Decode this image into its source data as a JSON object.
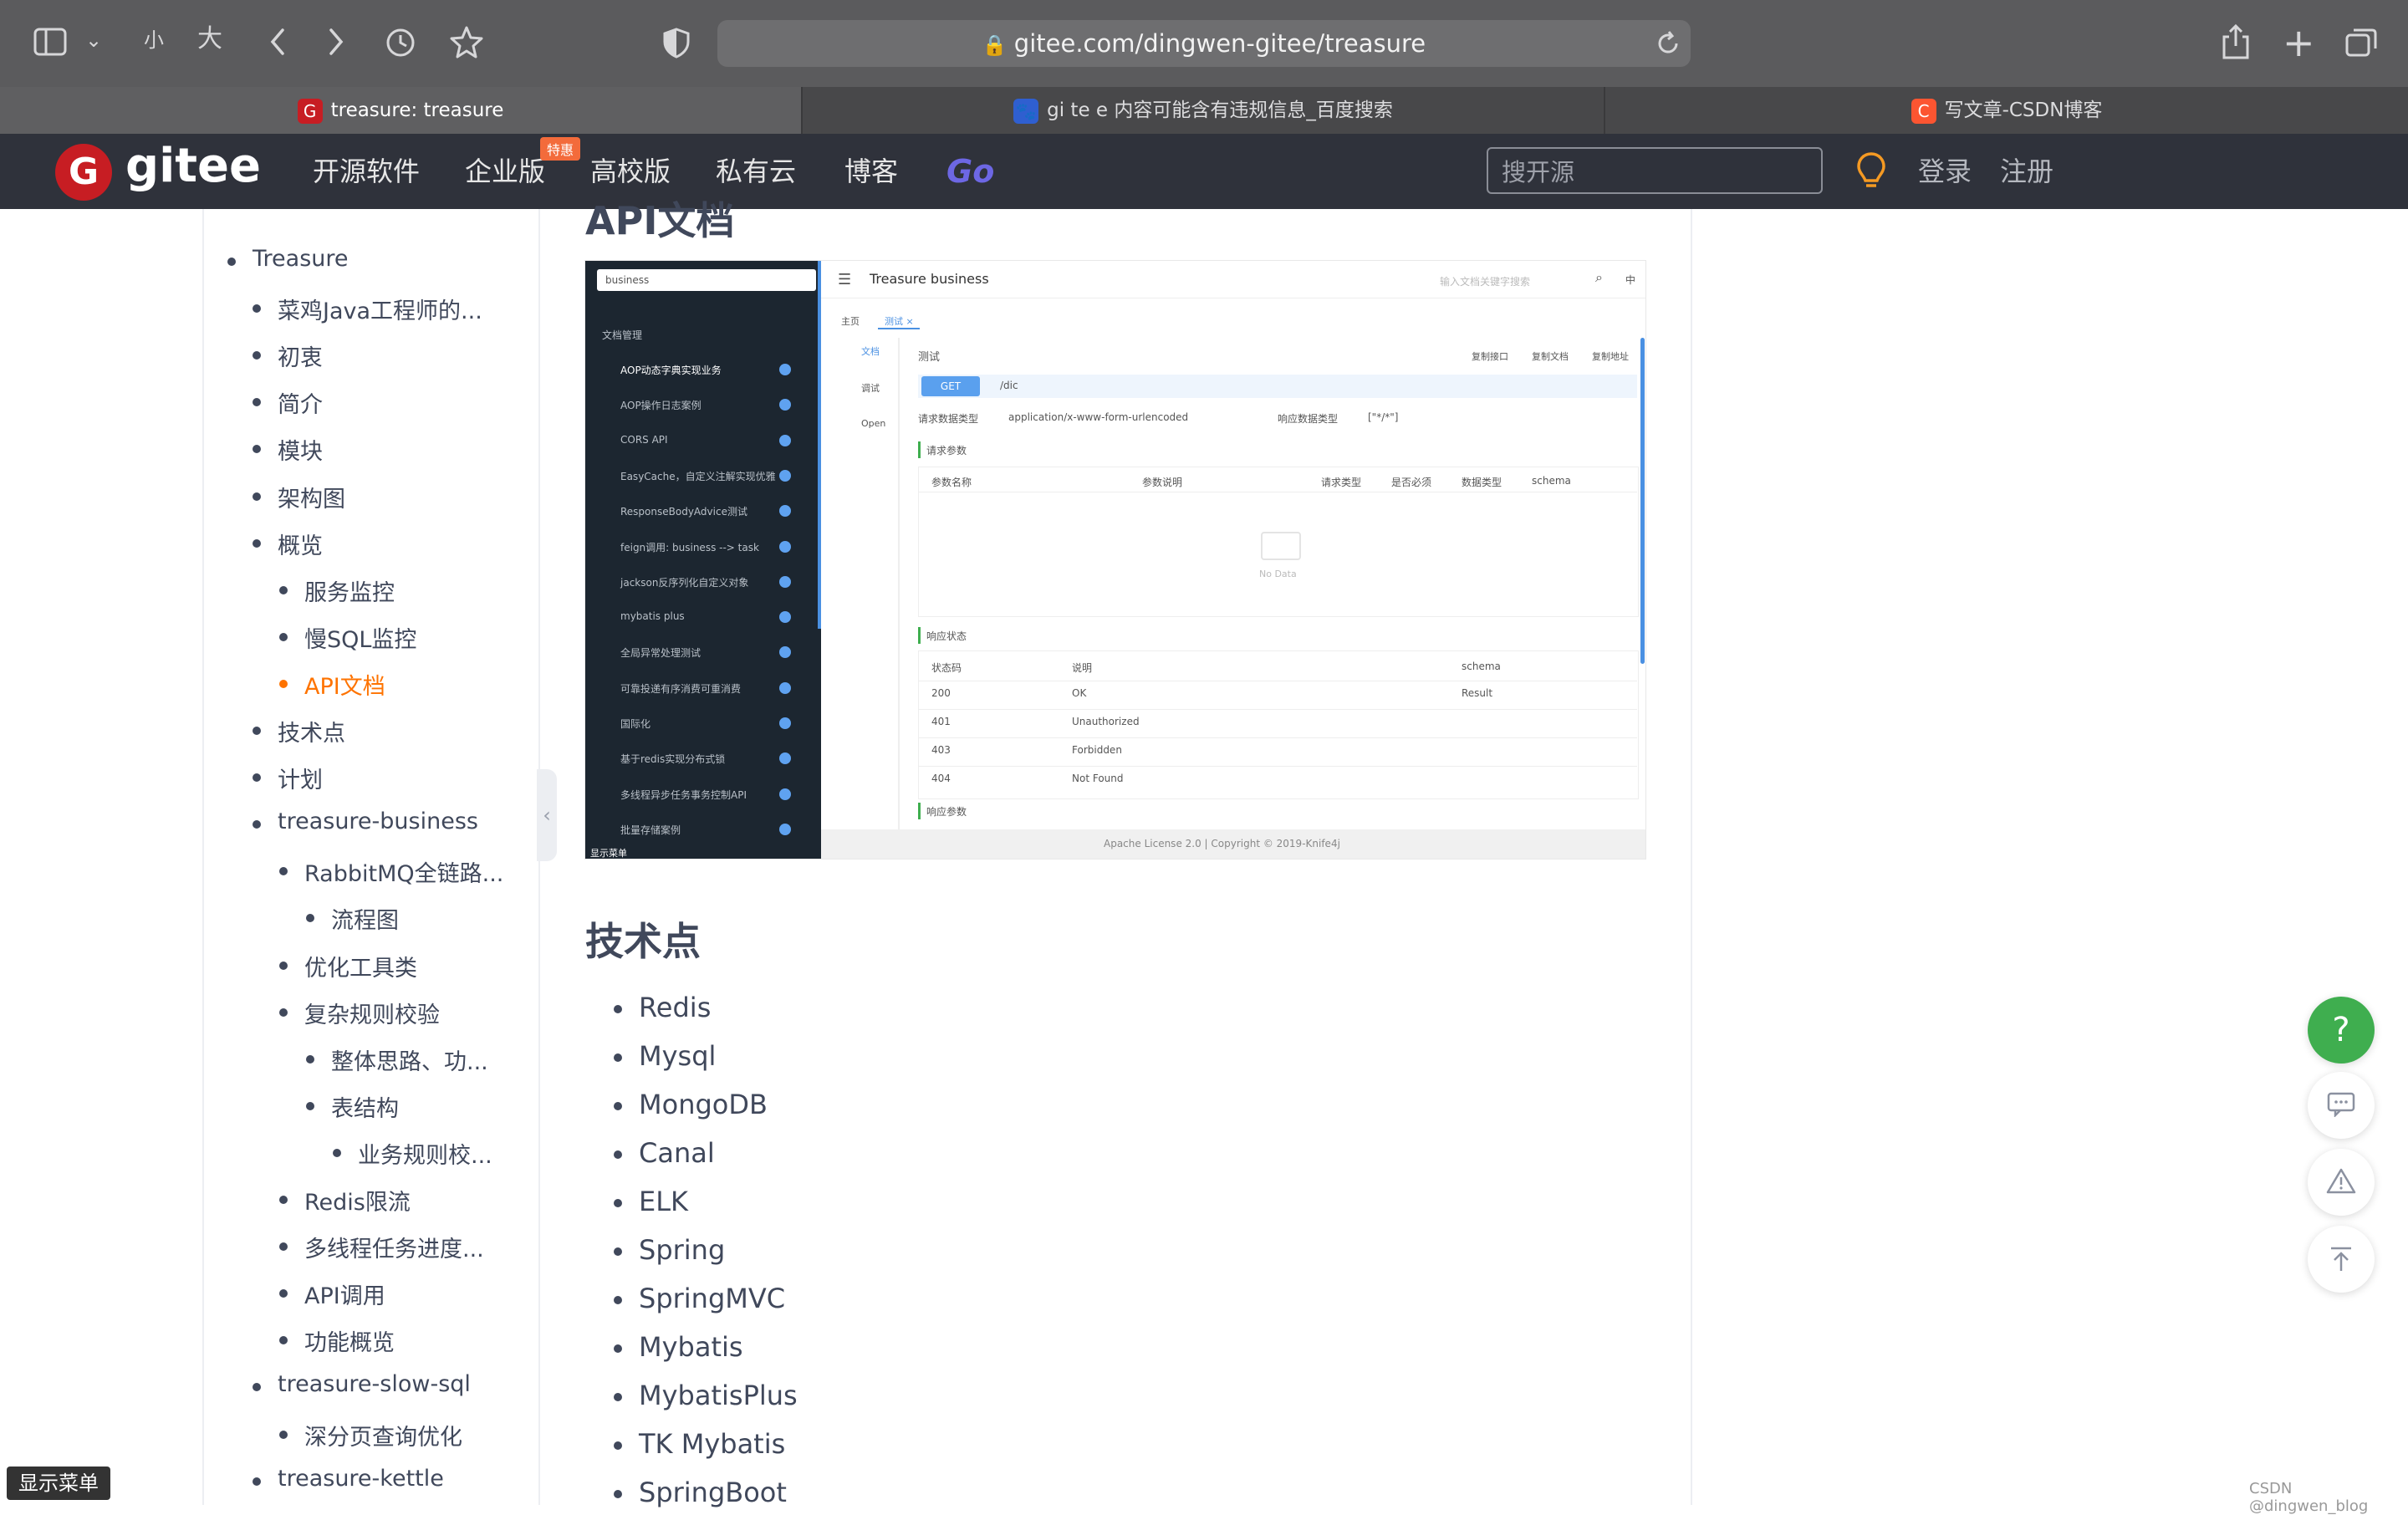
{
  "browser": {
    "url": "gitee.com/dingwen-gitee/treasure",
    "text_small": "小",
    "text_large": "大",
    "tabs": [
      {
        "label": "treasure: treasure",
        "active": true
      },
      {
        "label": "gi te e 内容可能含有违规信息_百度搜索",
        "active": false
      },
      {
        "label": "写文章-CSDN博客",
        "active": false
      }
    ]
  },
  "gitee": {
    "logo": "gitee",
    "nav": [
      "开源软件",
      "企业版",
      "高校版",
      "私有云",
      "博客",
      "Go"
    ],
    "badge": "特惠",
    "search_placeholder": "搜开源",
    "login": "登录",
    "register": "注册"
  },
  "sidebar": {
    "items": [
      {
        "label": "Treasure",
        "level": 0
      },
      {
        "label": "菜鸡Java工程师的...",
        "level": 1
      },
      {
        "label": "初衷",
        "level": 1
      },
      {
        "label": "简介",
        "level": 1
      },
      {
        "label": "模块",
        "level": 1
      },
      {
        "label": "架构图",
        "level": 1
      },
      {
        "label": "概览",
        "level": 1
      },
      {
        "label": "服务监控",
        "level": 2
      },
      {
        "label": "慢SQL监控",
        "level": 2
      },
      {
        "label": "API文档",
        "level": 2,
        "active": true
      },
      {
        "label": "技术点",
        "level": 1
      },
      {
        "label": "计划",
        "level": 1
      },
      {
        "label": "treasure-business",
        "level": 1
      },
      {
        "label": "RabbitMQ全链路...",
        "level": 2
      },
      {
        "label": "流程图",
        "level": 3
      },
      {
        "label": "优化工具类",
        "level": 2
      },
      {
        "label": "复杂规则校验",
        "level": 2
      },
      {
        "label": "整体思路、功...",
        "level": 3
      },
      {
        "label": "表结构",
        "level": 3
      },
      {
        "label": "业务规则校...",
        "level": 4
      },
      {
        "label": "Redis限流",
        "level": 2
      },
      {
        "label": "多线程任务进度...",
        "level": 2
      },
      {
        "label": "API调用",
        "level": 2
      },
      {
        "label": "功能概览",
        "level": 2
      },
      {
        "label": "treasure-slow-sql",
        "level": 1
      },
      {
        "label": "深分页查询优化",
        "level": 2
      },
      {
        "label": "treasure-kettle",
        "level": 1
      }
    ]
  },
  "main": {
    "api_heading": "API文档",
    "tech_heading": "技术点",
    "tech_items": [
      "Redis",
      "Mysql",
      "MongoDB",
      "Canal",
      "ELK",
      "Spring",
      "SpringMVC",
      "Mybatis",
      "MybatisPlus",
      "TK Mybatis",
      "SpringBoot"
    ]
  },
  "shot": {
    "select_value": "business",
    "header_title": "Treasure business",
    "search_placeholder": "输入文档关键字搜索",
    "lang": "中",
    "left_items": [
      "文档管理",
      "AOP动态字典实现业务",
      "AOP操作日志案例",
      "CORS API",
      "EasyCache，自定义注解实现优雅",
      "ResponseBodyAdvice测试",
      "feign调用: business --> task",
      "jackson反序列化自定义对象",
      "mybatis plus",
      "全局异常处理测试",
      "可靠投递有序消费可重消费",
      "国际化",
      "基于redis实现分布式锁",
      "多线程异步任务事务控制API",
      "批量存储案例"
    ],
    "left_footer": "显示菜单",
    "tab_home": "主页",
    "tab_test": "测试",
    "side_doc": "文档",
    "side_debug": "调试",
    "side_open": "Open",
    "section_title": "测试",
    "copy_api": "复制接口",
    "copy_doc": "复制文档",
    "copy_addr": "复制地址",
    "method": "GET",
    "path": "/dic",
    "req_type_label": "请求数据类型",
    "req_type": "application/x-www-form-urlencoded",
    "resp_type_label": "响应数据类型",
    "resp_type": "[\"*/*\"]",
    "req_params": "请求参数",
    "param_headers": [
      "参数名称",
      "参数说明",
      "请求类型",
      "是否必须",
      "数据类型",
      "schema"
    ],
    "no_data": "No Data",
    "resp_status": "响应状态",
    "status_headers": [
      "状态码",
      "说明",
      "schema"
    ],
    "status_rows": [
      [
        "200",
        "OK",
        "Result"
      ],
      [
        "401",
        "Unauthorized",
        ""
      ],
      [
        "403",
        "Forbidden",
        ""
      ],
      [
        "404",
        "Not Found",
        ""
      ]
    ],
    "resp_params": "响应参数",
    "footer": "Apache License 2.0 | Copyright © 2019-Knife4j"
  },
  "page": {
    "show_menu": "显示菜单",
    "watermark": "CSDN @dingwen_blog"
  }
}
